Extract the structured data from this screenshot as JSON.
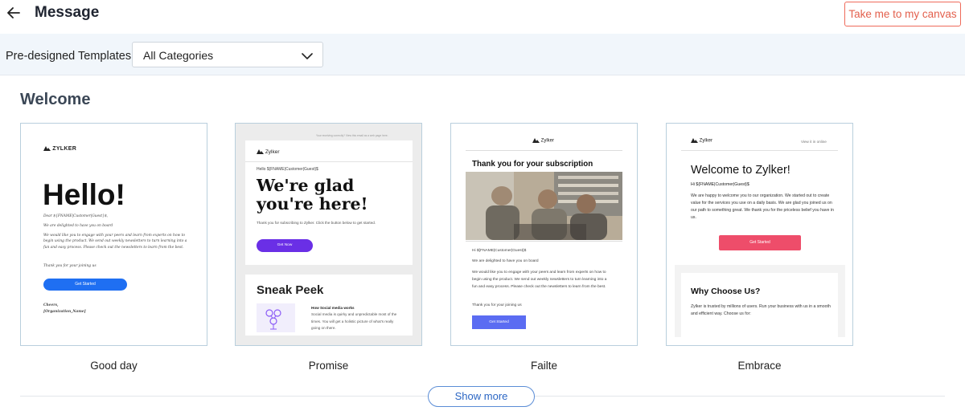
{
  "header": {
    "title": "Message",
    "canvas_button": "Take me to my canvas"
  },
  "filter": {
    "label": "Pre-designed Templates",
    "selected_category": "All Categories"
  },
  "section": {
    "title": "Welcome"
  },
  "templates": [
    {
      "name": "Good day",
      "preview": {
        "logo": "ZYLKER",
        "heading": "Hello!",
        "dear": "Dear ${FNAME|Customer|Guest}$,",
        "delighted": "We are delighted to have you on board",
        "body": "We would like you to engage with your peers and learn from experts on how to begin using the product. We send out weekly newsletters to turn learning into a fun and easy process. Please check out the newsletters to learn from the best.",
        "thanks": "Thank you for your joining us",
        "button": "Get Started",
        "cheers": "Cheers,",
        "org": "[Organization_Name]"
      }
    },
    {
      "name": "Promise",
      "preview": {
        "top_note": "Your receiving correctly? View this email as a web page here.",
        "logo": "Zylker",
        "greeting": "Hello ${FNAME|Customer|Guest}$",
        "heading": "We're glad you're here!",
        "thanks": "Thank you for subscribing to Zylker. Click the button below to get started.",
        "button": "Get Now",
        "sneak": "Sneak Peek",
        "article_title": "How Social media works",
        "article_body": "Social media is quirky and unpredictable most of the times. You will get a holistic picture of what's really going on there."
      }
    },
    {
      "name": "Failte",
      "preview": {
        "logo": "Zylker",
        "heading": "Thank you for your subscription",
        "greeting": "Hi ${FNAME|Customer|Guest}$",
        "delighted": "We are delighted to have you on board",
        "body": "We would like you to engage with your peers and learn from experts on how to begin using the product. We send out weekly newsletters to turn learning into a fun and easy process. Please check out the newsletters to learn from the best.",
        "thanks": "Thank you for your joining us",
        "button": "Get Started"
      }
    },
    {
      "name": "Embrace",
      "preview": {
        "logo": "Zylker",
        "view_online": "View it in online",
        "heading": "Welcome to Zylker!",
        "greeting": "Hi ${FNAME|Customer|Guest}$",
        "body": "We are happy to welcome you to our organization. We started out to create value for the services you use on a daily basis. We are glad you joined us on our path to something great. We thank you for the priceless belief you have in us.",
        "button": "Get Started",
        "why": "Why Choose Us?",
        "trust": "Zylker is trusted by millions of users. Run your business with us in a smooth and efficient way. Choose us for:"
      }
    }
  ],
  "show_more": "Show more",
  "colors": {
    "accent": "#e3604d",
    "link": "#2b66c4",
    "filter_bg": "#f1f6fb"
  }
}
